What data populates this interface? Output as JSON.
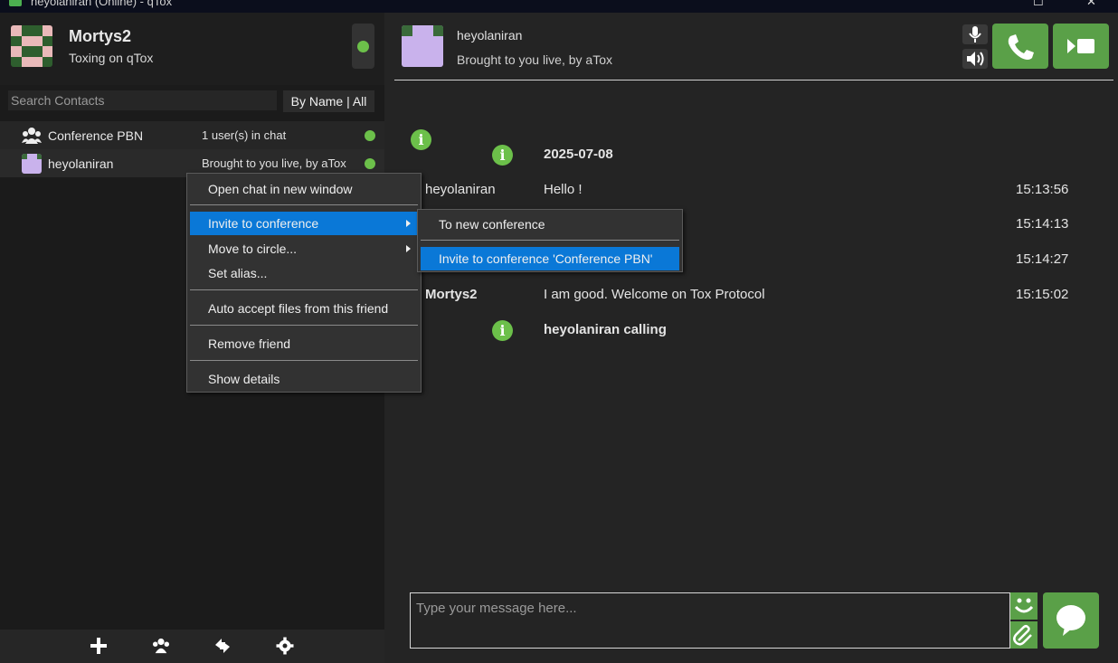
{
  "window": {
    "title": "heyolaniran (Online) - qTox"
  },
  "profile": {
    "name": "Mortys2",
    "status_message": "Toxing on qTox",
    "status": "online"
  },
  "search": {
    "placeholder": "Search Contacts"
  },
  "sort": {
    "label": "By Name | All"
  },
  "contacts": [
    {
      "name": "Conference PBN",
      "status": "1 user(s) in chat",
      "icon": "group-icon"
    },
    {
      "name": "heyolaniran",
      "status": "Brought to you live, by aTox",
      "icon": "avatar"
    }
  ],
  "chat_header": {
    "name": "heyolaniran",
    "status": "Brought to you live, by aTox"
  },
  "messages": [
    {
      "type": "date",
      "text": "2025-07-08"
    },
    {
      "author": "heyolaniran",
      "text": "Hello !",
      "time": "15:13:56"
    },
    {
      "author": "",
      "text": "",
      "time": "15:14:13"
    },
    {
      "author": "",
      "text": "",
      "time": "15:14:27"
    },
    {
      "author": "Mortys2",
      "text": "I am good. Welcome on Tox Protocol",
      "time": "15:15:02"
    },
    {
      "type": "notice",
      "text": "heyolaniran calling"
    }
  ],
  "input": {
    "placeholder": "Type your message here..."
  },
  "context_menu": {
    "items": [
      "Open chat in new window",
      "Invite to conference",
      "Move to circle...",
      "Set alias...",
      "Auto accept files from this friend",
      "Remove friend",
      "Show details"
    ]
  },
  "submenu": {
    "items": [
      "To new conference",
      "Invite to conference 'Conference PBN'"
    ]
  },
  "colors": {
    "accent": "#5aa048",
    "online": "#6cc04a",
    "selection": "#0a78d7"
  }
}
